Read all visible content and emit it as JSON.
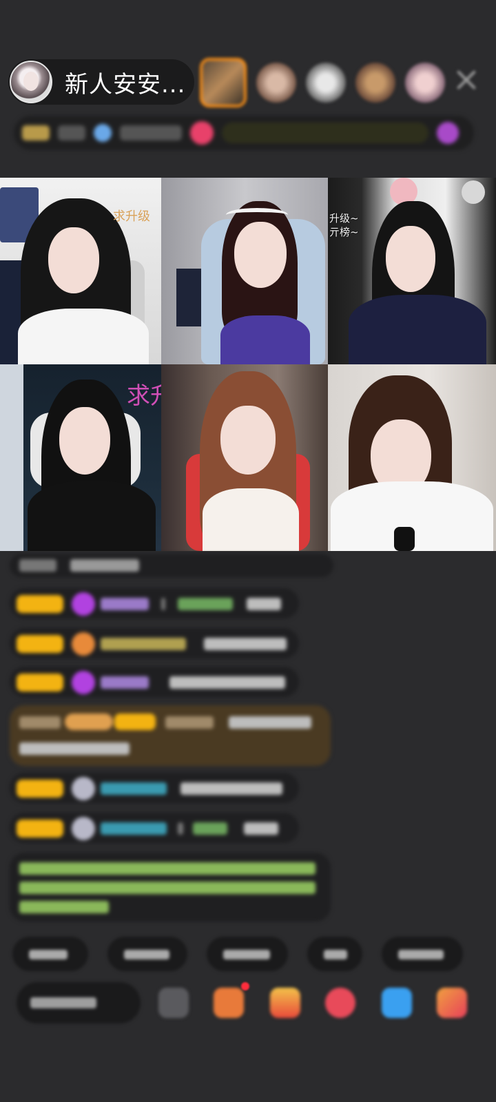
{
  "header": {
    "host_name": "新人安安...",
    "avatar_icon": "host-avatar",
    "close_icon": "close-icon"
  },
  "grid": {
    "tiles": [
      {
        "overlay": "求升级"
      },
      {
        "overlay": ""
      },
      {
        "overlay_line1": "升级~",
        "overlay_line2": "亓榜~"
      },
      {
        "overlay": "求升"
      },
      {
        "overlay": ""
      },
      {
        "overlay": ""
      }
    ]
  },
  "colors": {
    "background": "#2b2b2d",
    "pill": "#1b1b1c",
    "badge_gold": "#f3b312",
    "accent_orange": "#f08a18",
    "accent_pink": "#d04fb6"
  }
}
